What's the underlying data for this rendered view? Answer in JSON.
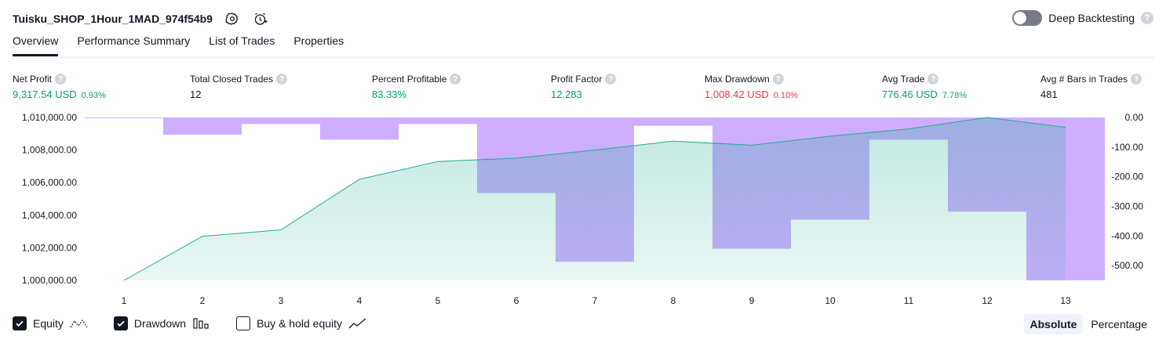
{
  "header": {
    "strategy_name": "Tuisku_SHOP_1Hour_1MAD_974f54b9",
    "deep_backtesting_label": "Deep Backtesting",
    "help_glyph": "?"
  },
  "tabs": [
    {
      "label": "Overview",
      "active": true
    },
    {
      "label": "Performance Summary",
      "active": false
    },
    {
      "label": "List of Trades",
      "active": false
    },
    {
      "label": "Properties",
      "active": false
    }
  ],
  "metrics": {
    "net_profit": {
      "label": "Net Profit",
      "value": "9,317.54 USD",
      "sub": "0.93%"
    },
    "total_closed_trades": {
      "label": "Total Closed Trades",
      "value": "12"
    },
    "percent_profitable": {
      "label": "Percent Profitable",
      "value": "83.33%"
    },
    "profit_factor": {
      "label": "Profit Factor",
      "value": "12.283"
    },
    "max_drawdown": {
      "label": "Max Drawdown",
      "value": "1,008.42 USD",
      "sub": "0.10%"
    },
    "avg_trade": {
      "label": "Avg Trade",
      "value": "776.46 USD",
      "sub": "7.78%"
    },
    "avg_bars": {
      "label": "Avg # Bars in Trades",
      "value": "481"
    }
  },
  "colors": {
    "green": "#089981",
    "red": "#f23645",
    "equity_line": "#22ab94",
    "drawdown_bar": "#c9a5ff",
    "accent": "#131722"
  },
  "chart_data": {
    "type": "area",
    "x": [
      1,
      2,
      3,
      4,
      5,
      6,
      7,
      8,
      9,
      10,
      11,
      12,
      13
    ],
    "x_tick_labels": [
      "1",
      "2",
      "3",
      "4",
      "5",
      "6",
      "7",
      "8",
      "9",
      "10",
      "11",
      "12",
      "13"
    ],
    "left_axis": {
      "ticks": [
        "1,010,000.00",
        "1,008,000.00",
        "1,006,000.00",
        "1,004,000.00",
        "1,002,000.00",
        "1,000,000.00"
      ],
      "tick_values": [
        1010000,
        1008000,
        1006000,
        1004000,
        1002000,
        1000000
      ],
      "ylim": [
        1000000,
        1010000
      ]
    },
    "right_axis": {
      "ticks": [
        "0.00",
        "-100.00",
        "-200.00",
        "-300.00",
        "-400.00",
        "-500.00"
      ],
      "tick_values": [
        0,
        -100,
        -200,
        -300,
        -400,
        -500
      ],
      "ylim": [
        -550,
        0
      ]
    },
    "series": [
      {
        "name": "Equity",
        "type": "area",
        "axis": "left",
        "values": [
          1000000,
          1002700,
          1003100,
          1006200,
          1007300,
          1007500,
          1008000,
          1008550,
          1008300,
          1008850,
          1009300,
          1010000,
          1009400
        ]
      },
      {
        "name": "Drawdown",
        "type": "bar",
        "axis": "right",
        "values": [
          -2,
          -58,
          -22,
          -75,
          -22,
          -255,
          -487,
          -28,
          -443,
          -345,
          -75,
          -318,
          -550
        ]
      }
    ],
    "grid": false,
    "legend_position": "bottom-left"
  },
  "legend": {
    "equity": {
      "label": "Equity",
      "checked": true,
      "icon": "equity-line-icon"
    },
    "drawdown": {
      "label": "Drawdown",
      "checked": true,
      "icon": "drawdown-bars-icon"
    },
    "buy_hold": {
      "label": "Buy & hold equity",
      "checked": false,
      "icon": "buy-hold-line-icon"
    }
  },
  "mode": {
    "absolute_label": "Absolute",
    "percentage_label": "Percentage",
    "active": "Absolute"
  }
}
